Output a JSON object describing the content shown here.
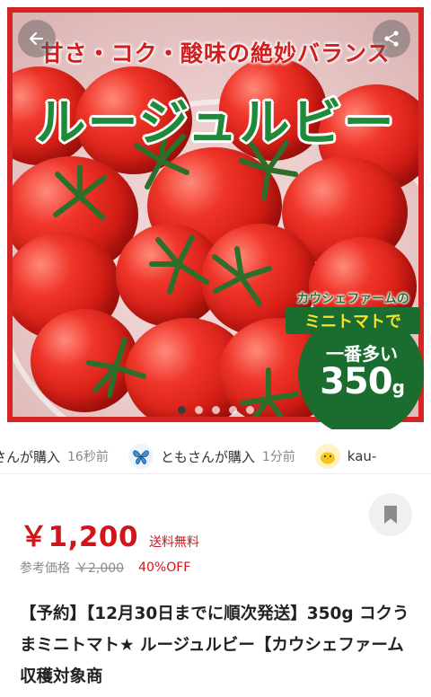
{
  "hero": {
    "headline_top": "甘さ・コク・酸味の絶妙バランス",
    "headline_main": "ルージュルビー",
    "badge": {
      "line1": "カウシェファームの",
      "line2": "ミニトマトで",
      "line3": "一番多い",
      "amount": "350",
      "unit": "g"
    },
    "carousel": {
      "count": 5,
      "active_index": 0
    },
    "frame_color": "#d42424",
    "accent_green": "#1f8a3a"
  },
  "nav": {
    "back_icon": "arrow-left-icon",
    "share_icon": "share-icon"
  },
  "ticker": {
    "items": [
      {
        "user_text": "さんが購入",
        "time": "16秒前",
        "avatar": "none"
      },
      {
        "user_text": "ともさんが購入",
        "time": "1分前",
        "avatar": "butterfly-icon"
      },
      {
        "user_text": "kau-",
        "time": "",
        "avatar": "chick-icon"
      }
    ]
  },
  "price": {
    "value": "￥1,200",
    "shipping": "送料無料",
    "reference_label": "参考価格",
    "reference_value": "￥2,000",
    "discount": "40%OFF",
    "color": "#d0161a"
  },
  "product": {
    "title": "【予約】【12月30日までに順次発送】350g コクうまミニトマト★ ルージュルビー【カウシェファーム収穫対象商"
  },
  "bookmark": {
    "icon": "bookmark-icon"
  }
}
